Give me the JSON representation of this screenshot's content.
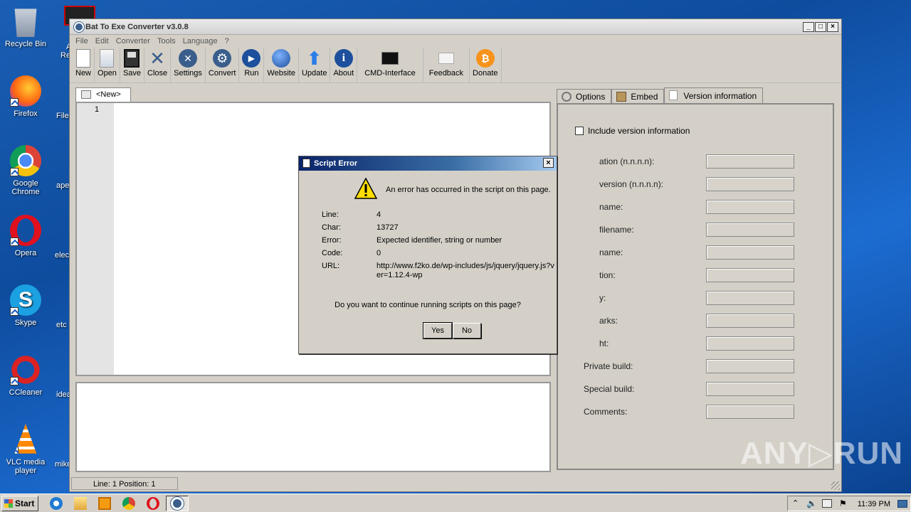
{
  "desktop": {
    "icons": [
      {
        "label": "Recycle Bin"
      },
      {
        "label": "Firefox"
      },
      {
        "label": "Google Chrome"
      },
      {
        "label": "Opera"
      },
      {
        "label": "Skype"
      },
      {
        "label": "CCleaner"
      },
      {
        "label": "VLC media player"
      }
    ],
    "cut_labels": [
      "Ad",
      "Re",
      "File",
      "ape",
      "elec",
      "etc",
      "idea",
      "mike"
    ]
  },
  "window": {
    "title": "Bat To Exe Converter v3.0.8",
    "controls": {
      "minimize": "_",
      "maximize": "□",
      "close": "×"
    },
    "menu": [
      "File",
      "Edit",
      "Converter",
      "Tools",
      "Language",
      "?"
    ],
    "toolbar": [
      {
        "label": "New",
        "icon": "new-file-icon"
      },
      {
        "label": "Open",
        "icon": "open-folder-icon"
      },
      {
        "label": "Save",
        "icon": "floppy-disk-icon"
      },
      {
        "label": "Close",
        "icon": "close-x-icon"
      },
      {
        "label": "Settings",
        "icon": "wrench-screwdriver-icon"
      },
      {
        "label": "Convert",
        "icon": "gear-icon"
      },
      {
        "label": "Run",
        "icon": "play-icon"
      },
      {
        "label": "Website",
        "icon": "globe-icon"
      },
      {
        "label": "Update",
        "icon": "up-arrow-icon"
      },
      {
        "label": "About",
        "icon": "info-icon"
      },
      {
        "label": "CMD-Interface",
        "icon": "terminal-icon"
      },
      {
        "label": "Feedback",
        "icon": "envelope-icon"
      },
      {
        "label": "Donate",
        "icon": "bitcoin-icon"
      }
    ],
    "editor_tab": "<New>",
    "line_number": "1",
    "status": "Line: 1  Position: 1",
    "right_tabs": [
      {
        "label": "Options"
      },
      {
        "label": "Embed"
      },
      {
        "label": "Version information"
      }
    ],
    "include_version_label": "Include version information",
    "fields": [
      "ation (n.n.n.n):",
      "version (n.n.n.n):",
      "name:",
      "filename:",
      "name:",
      "tion:",
      "y:",
      "arks:",
      "ht:",
      "Private build:",
      "Special build:",
      "Comments:"
    ]
  },
  "dialog": {
    "title": "Script Error",
    "message": "An error has occurred in the script on this page.",
    "details": [
      {
        "key": "Line:",
        "value": "4"
      },
      {
        "key": "Char:",
        "value": "13727"
      },
      {
        "key": "Error:",
        "value": "Expected identifier, string or number"
      },
      {
        "key": "Code:",
        "value": "0"
      },
      {
        "key": "URL:",
        "value": "http://www.f2ko.de/wp-includes/js/jquery/jquery.js?ver=1.12.4-wp"
      }
    ],
    "question": "Do you want to continue running scripts on this page?",
    "yes": "Yes",
    "no": "No",
    "close": "×"
  },
  "taskbar": {
    "start": "Start",
    "time": "11:39 PM"
  },
  "watermark": "ANY▷RUN"
}
